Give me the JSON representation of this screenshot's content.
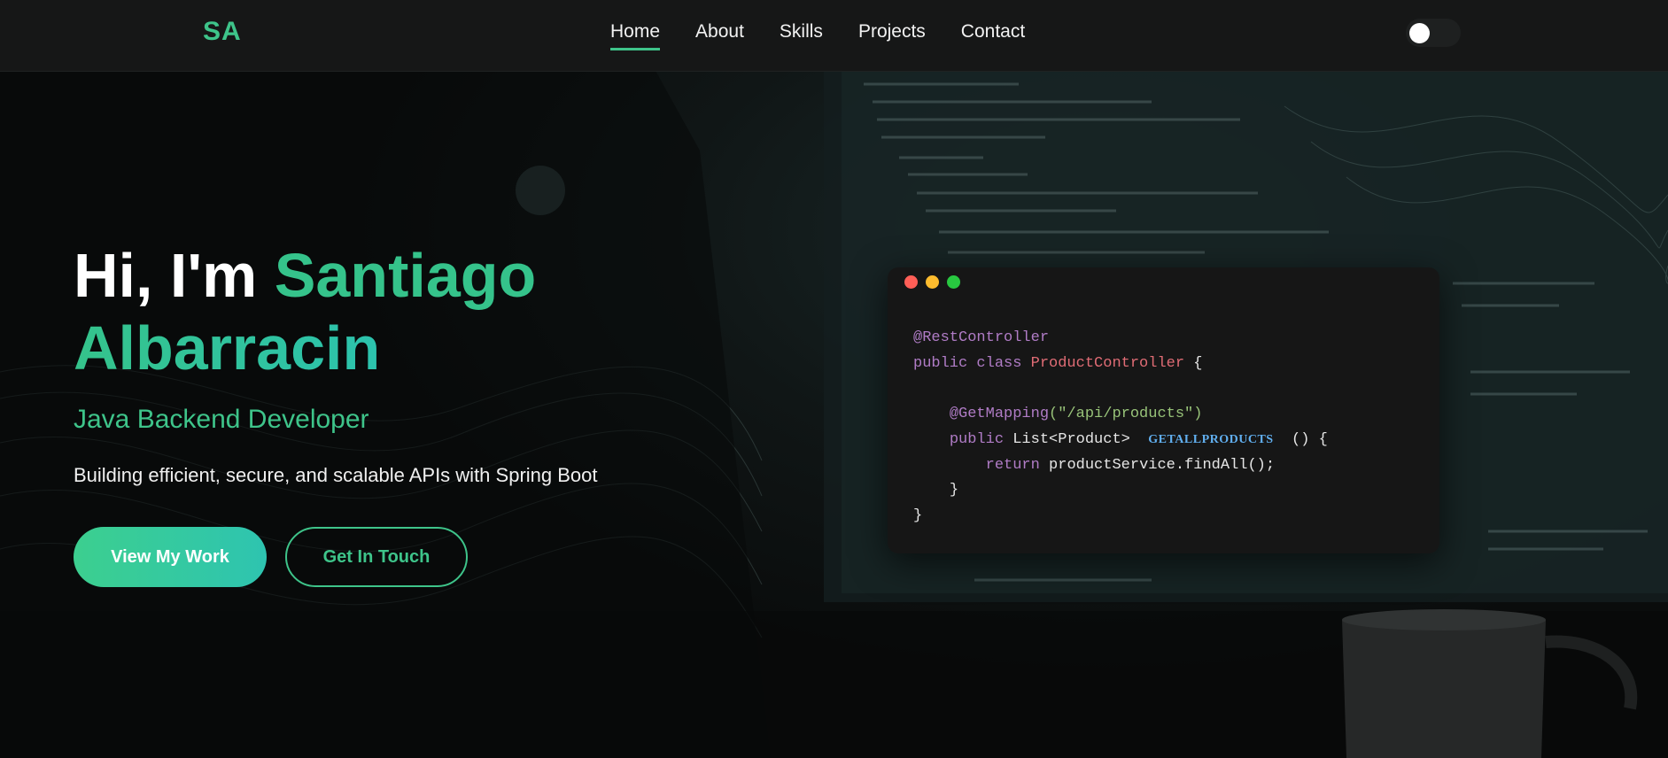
{
  "brand": {
    "logo": "SA",
    "accent_color": "#3ec48a"
  },
  "nav": {
    "items": [
      {
        "label": "Home",
        "active": true
      },
      {
        "label": "About",
        "active": false
      },
      {
        "label": "Skills",
        "active": false
      },
      {
        "label": "Projects",
        "active": false
      },
      {
        "label": "Contact",
        "active": false
      }
    ],
    "theme_toggle": {
      "state": "dark",
      "icon": "toggle-switch-icon"
    }
  },
  "hero": {
    "greeting": "Hi, I'm",
    "first_name": "Santiago",
    "last_name": "Albarracin",
    "role": "Java Backend Developer",
    "tagline": "Building efficient, secure, and scalable APIs with Spring Boot",
    "primary_button": "View My Work",
    "secondary_button": "Get In Touch"
  },
  "code_window": {
    "window_dots": [
      "#ff5f57",
      "#febc2e",
      "#28c840"
    ],
    "lines": {
      "l1_annotation": "@RestController",
      "l2_kw": "public class",
      "l2_class": "ProductController",
      "l2_brace": "{",
      "l4_annotation": "@GetMapping",
      "l4_arg": "(\"/api/products\")",
      "l5_kw": "public",
      "l5_type": "List<Product>",
      "l5_method": "GETALLPRODUCTS",
      "l5_rest": "() {",
      "l6_kw": "return",
      "l6_expr": "productService.findAll();",
      "l7": "}",
      "l8": "}"
    }
  }
}
